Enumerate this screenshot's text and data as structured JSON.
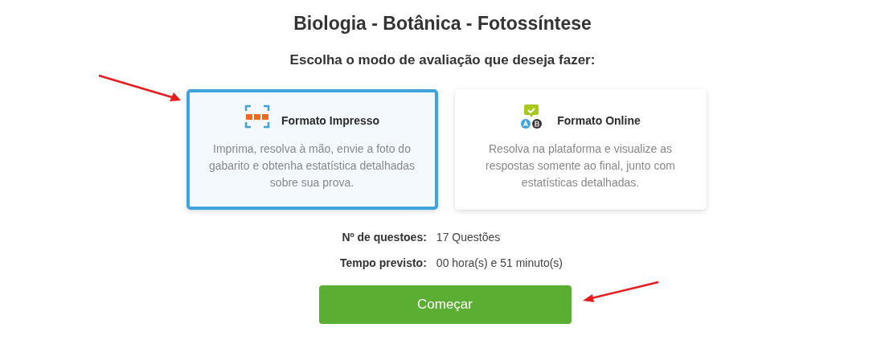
{
  "title": "Biologia - Botânica - Fotossíntese",
  "subtitle": "Escolha o modo de avaliação que deseja fazer:",
  "modes": [
    {
      "kind": "print",
      "title": "Formato Impresso",
      "description": "Imprima, resolva à mão, envie a foto do gabarito e obtenha estatística detalhadas sobre sua prova.",
      "selected": true
    },
    {
      "kind": "online",
      "title": "Formato Online",
      "description": "Resolva na plataforma e visualize as respostas somente ao final, junto com estatísticas detalhadas.",
      "selected": false
    }
  ],
  "info": [
    {
      "label": "Nº de questoes:",
      "value": "17 Questões"
    },
    {
      "label": "Tempo previsto:",
      "value": "00 hora(s) e 51 minuto(s)"
    }
  ],
  "start_button": "Começar"
}
